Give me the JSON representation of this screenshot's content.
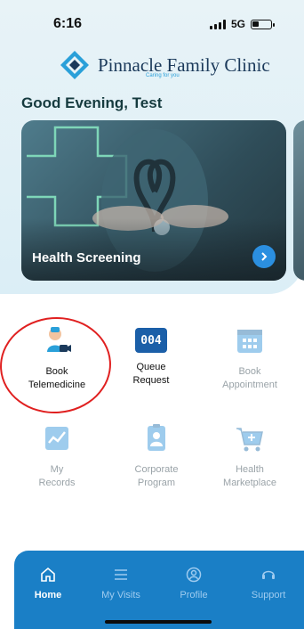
{
  "status_bar": {
    "time": "6:16",
    "network": "5G"
  },
  "brand": {
    "name": "Pinnacle Family Clinic",
    "tagline": "Caring for you"
  },
  "greeting": "Good Evening, Test",
  "banner": {
    "title": "Health Screening",
    "arrow_icon": "chevron-right-icon"
  },
  "menu": [
    {
      "label_line1": "Book",
      "label_line2": "Telemedicine",
      "icon": "doctor-video-icon",
      "enabled": true
    },
    {
      "label_line1": "Queue",
      "label_line2": "Request",
      "icon": "queue-number-icon",
      "enabled": true,
      "queue_number": "004"
    },
    {
      "label_line1": "Book",
      "label_line2": "Appointment",
      "icon": "calendar-icon",
      "enabled": false
    },
    {
      "label_line1": "My",
      "label_line2": "Records",
      "icon": "records-chart-icon",
      "enabled": false
    },
    {
      "label_line1": "Corporate",
      "label_line2": "Program",
      "icon": "id-badge-icon",
      "enabled": false
    },
    {
      "label_line1": "Health",
      "label_line2": "Marketplace",
      "icon": "cart-icon",
      "enabled": false
    }
  ],
  "tabs": [
    {
      "label": "Home",
      "icon": "home-icon",
      "active": true
    },
    {
      "label": "My Visits",
      "icon": "list-icon",
      "active": false
    },
    {
      "label": "Profile",
      "icon": "profile-icon",
      "active": false
    },
    {
      "label": "Support",
      "icon": "support-icon",
      "active": false
    }
  ],
  "colors": {
    "accent": "#1a7fc6",
    "brand_navy": "#1b3a5b",
    "highlight_ring": "#e02020"
  }
}
